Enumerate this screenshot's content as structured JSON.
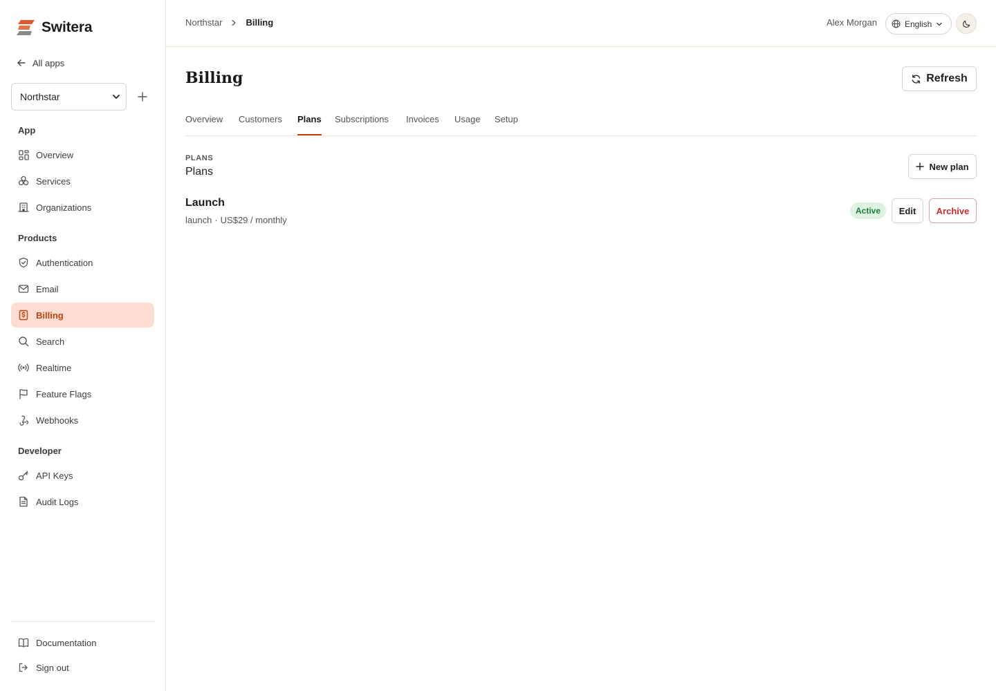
{
  "brand": {
    "name": "Switera",
    "accent": "#e0572a"
  },
  "sidebar": {
    "all_apps": "All apps",
    "app_select": {
      "value": "Northstar"
    },
    "sections": {
      "app": "App",
      "products": "Products",
      "developer": "Developer"
    },
    "items": [
      {
        "label": "Overview",
        "icon": "grid-icon"
      },
      {
        "label": "Services",
        "icon": "services-icon"
      },
      {
        "label": "Organizations",
        "icon": "building-icon"
      },
      {
        "label": "Authentication",
        "icon": "shield-icon"
      },
      {
        "label": "Email",
        "icon": "mail-icon"
      },
      {
        "label": "Billing",
        "icon": "billing-icon",
        "active": true
      },
      {
        "label": "Search",
        "icon": "search-icon"
      },
      {
        "label": "Realtime",
        "icon": "broadcast-icon"
      },
      {
        "label": "Feature Flags",
        "icon": "flag-icon"
      },
      {
        "label": "Webhooks",
        "icon": "webhook-icon"
      },
      {
        "label": "API Keys",
        "icon": "key-icon"
      },
      {
        "label": "Audit Logs",
        "icon": "file-icon"
      }
    ],
    "footer": [
      {
        "label": "Documentation",
        "icon": "book-icon"
      },
      {
        "label": "Sign out",
        "icon": "sign-out-icon"
      }
    ]
  },
  "header": {
    "breadcrumb": {
      "parent": "Northstar",
      "current": "Billing"
    },
    "user": "Alex Morgan",
    "language": "English"
  },
  "main": {
    "title": "Billing",
    "refresh_label": "Refresh",
    "tabs": [
      {
        "label": "Overview"
      },
      {
        "label": "Customers"
      },
      {
        "label": "Plans",
        "active": true
      },
      {
        "label": "Subscriptions"
      },
      {
        "label": "Invoices"
      },
      {
        "label": "Usage"
      },
      {
        "label": "Setup"
      }
    ],
    "section": {
      "eyebrow": "PLANS",
      "title": "Plans",
      "new_label": "New plan"
    },
    "plans": [
      {
        "name": "Launch",
        "slug": "launch",
        "separator": "·",
        "price": "US$29 / monthly",
        "status": "Active",
        "edit_label": "Edit",
        "archive_label": "Archive"
      }
    ]
  },
  "colors": {
    "active_nav_bg": "#fdddd2",
    "active_nav_text": "#c2410c",
    "status_active_bg": "#def2e1",
    "status_active_text": "#1f7a3a",
    "danger": "#c92a2a"
  }
}
